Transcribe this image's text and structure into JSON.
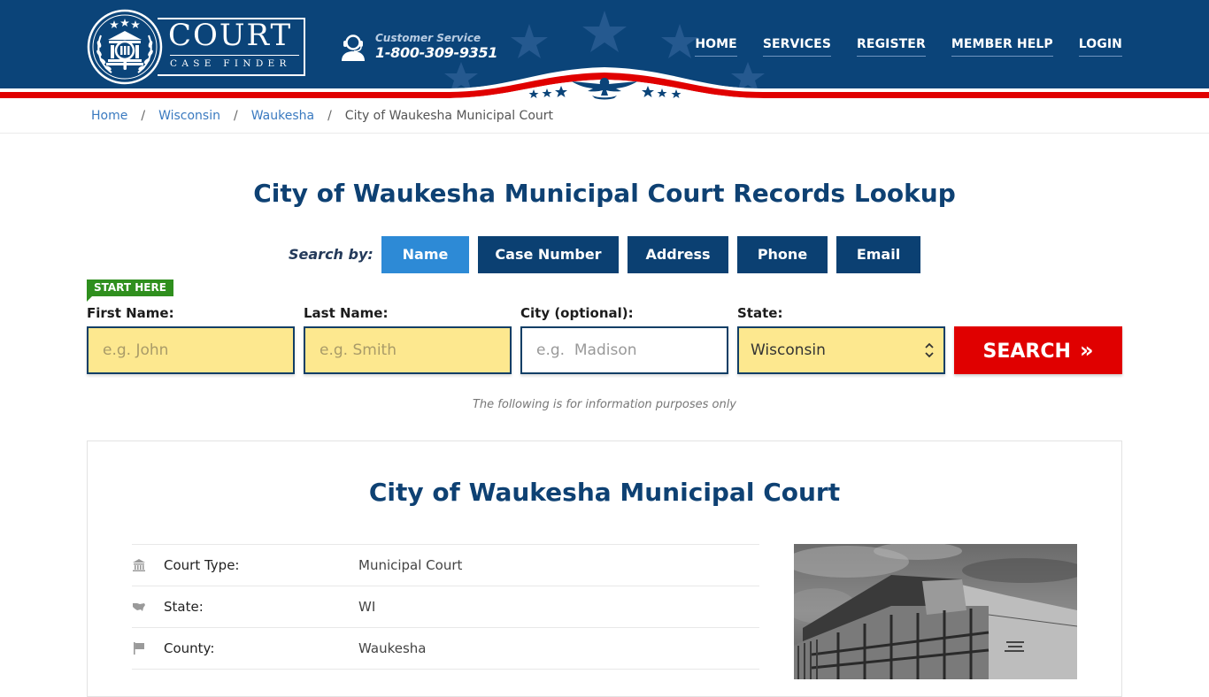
{
  "brand": {
    "name": "COURT",
    "tagline": "CASE FINDER"
  },
  "customer_service": {
    "label": "Customer Service",
    "phone": "1-800-309-9351"
  },
  "nav": {
    "items": [
      {
        "label": "HOME"
      },
      {
        "label": "SERVICES"
      },
      {
        "label": "REGISTER"
      },
      {
        "label": "MEMBER HELP"
      },
      {
        "label": "LOGIN"
      }
    ]
  },
  "breadcrumb": {
    "items": [
      {
        "label": "Home"
      },
      {
        "label": "Wisconsin"
      },
      {
        "label": "Waukesha"
      }
    ],
    "current": "City of Waukesha Municipal Court",
    "separator": "/"
  },
  "page": {
    "title": "City of Waukesha Municipal Court Records Lookup"
  },
  "search": {
    "by_label": "Search by:",
    "tabs": [
      {
        "label": "Name",
        "active": true
      },
      {
        "label": "Case Number",
        "active": false
      },
      {
        "label": "Address",
        "active": false
      },
      {
        "label": "Phone",
        "active": false
      },
      {
        "label": "Email",
        "active": false
      }
    ],
    "badge": "START HERE",
    "fields": {
      "first_name": {
        "label": "First Name:",
        "placeholder": "e.g. John",
        "value": ""
      },
      "last_name": {
        "label": "Last Name:",
        "placeholder": "e.g. Smith",
        "value": ""
      },
      "city": {
        "label": "City (optional):",
        "placeholder": "e.g.  Madison",
        "value": ""
      },
      "state": {
        "label": "State:",
        "value": "Wisconsin"
      }
    },
    "submit_label": "SEARCH",
    "submit_icon": "double-chevron-right",
    "note": "The following is for information purposes only"
  },
  "court": {
    "title": "City of Waukesha Municipal Court",
    "details": [
      {
        "icon": "courthouse-icon",
        "label": "Court Type:",
        "value": "Municipal Court"
      },
      {
        "icon": "us-map-icon",
        "label": "State:",
        "value": "WI"
      },
      {
        "icon": "flag-icon",
        "label": "County:",
        "value": "Waukesha"
      }
    ],
    "photo_alt": "City of Waukesha Municipal Court building"
  },
  "colors": {
    "header_blue": "#0b4479",
    "accent_red": "#e00000",
    "active_tab": "#2d8ad6",
    "tab": "#0b4072",
    "input_fill": "#fde88f",
    "start_badge": "#2f8f1e",
    "title": "#0e4173"
  }
}
